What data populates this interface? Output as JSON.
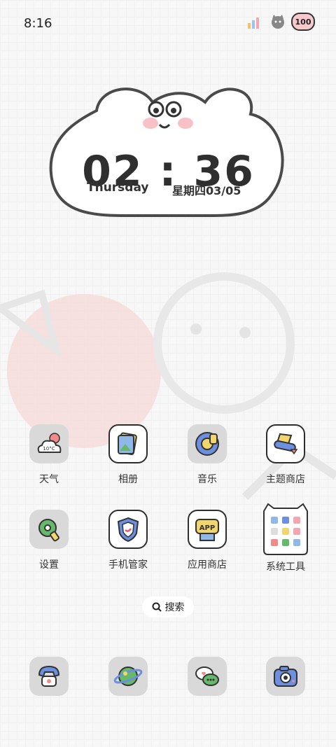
{
  "status_bar": {
    "time": "8:16",
    "battery": "100"
  },
  "clock_widget": {
    "time": "02 : 36",
    "weekday_en": "Thursday",
    "date_cn": "星期四03/05"
  },
  "apps_row1": [
    {
      "label": "天气",
      "icon": "weather-icon",
      "temp": "10°C"
    },
    {
      "label": "相册",
      "icon": "gallery-icon"
    },
    {
      "label": "音乐",
      "icon": "music-icon"
    },
    {
      "label": "主题商店",
      "icon": "theme-store-icon"
    }
  ],
  "apps_row2": [
    {
      "label": "设置",
      "icon": "settings-icon"
    },
    {
      "label": "手机管家",
      "icon": "phone-manager-icon"
    },
    {
      "label": "应用商店",
      "icon": "app-store-icon",
      "badge": "APP"
    },
    {
      "label": "系统工具",
      "icon": "system-tools-folder-icon"
    }
  ],
  "search": {
    "label": "搜索"
  },
  "dock": [
    {
      "icon": "phone-icon"
    },
    {
      "icon": "browser-icon"
    },
    {
      "icon": "messages-icon"
    },
    {
      "icon": "camera-icon"
    }
  ],
  "colors": {
    "outline": "#2e2e2e",
    "tile_bg": "#d9d9d9",
    "pink": "#f4a7b0",
    "blue": "#6c8fe0",
    "green": "#66b96a",
    "yellow": "#f3d66b"
  }
}
